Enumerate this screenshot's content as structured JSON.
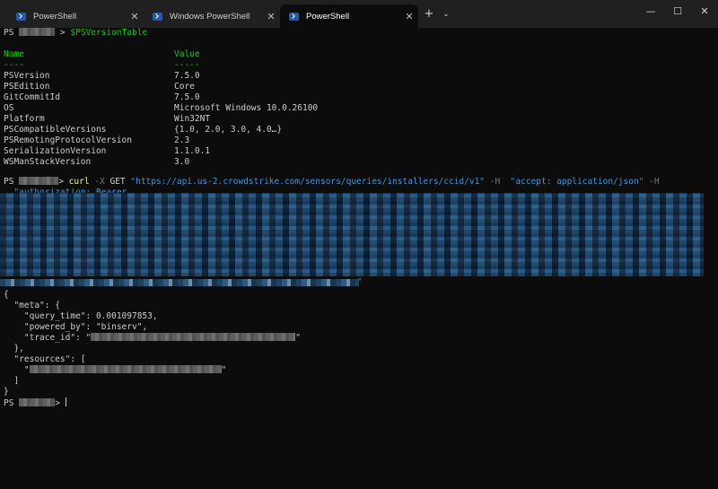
{
  "window": {
    "tabs": [
      {
        "label": "PowerShell",
        "active": false,
        "icon": "powershell-icon"
      },
      {
        "label": "Windows PowerShell",
        "active": false,
        "icon": "powershell-icon"
      },
      {
        "label": "PowerShell",
        "active": true,
        "icon": "powershell-icon"
      }
    ],
    "new_tab": "+",
    "tab_dropdown": "⌄",
    "controls": {
      "minimize": "—",
      "maximize": "☐",
      "close": "✕"
    }
  },
  "terminal": {
    "prompt_prefix": "PS",
    "prompt_suffix": ">",
    "cmd1": "$PSVersionTable",
    "table": {
      "headers": [
        "Name",
        "Value"
      ],
      "underlines": [
        "----",
        "-----"
      ],
      "rows": [
        [
          "PSVersion",
          "7.5.0"
        ],
        [
          "PSEdition",
          "Core"
        ],
        [
          "GitCommitId",
          "7.5.0"
        ],
        [
          "OS",
          "Microsoft Windows 10.0.26100"
        ],
        [
          "Platform",
          "Win32NT"
        ],
        [
          "PSCompatibleVersions",
          "{1.0, 2.0, 3.0, 4.0…}"
        ],
        [
          "PSRemotingProtocolVersion",
          "2.3"
        ],
        [
          "SerializationVersion",
          "1.1.0.1"
        ],
        [
          "WSManStackVersion",
          "3.0"
        ]
      ]
    },
    "curl": {
      "cmd": "curl",
      "flag_x": "-X",
      "method": "GET",
      "url": "\"https://api.us-2.crowdstrike.com/sensors/queries/installers/ccid/v1\"",
      "flag_h": "-H",
      "accept": "\"accept: application/json\"",
      "flag_h2": "-H",
      "auth": "\"authorization: Bearer",
      "auth_close": "\""
    },
    "json_output": {
      "l1": "{",
      "l2": "  \"meta\": {",
      "l3_key": "    \"query_time\": ",
      "l3_val": "0.001097853,",
      "l4_key": "    \"powered_by\": ",
      "l4_val": "\"binserv\",",
      "l5_key": "    \"trace_id\": ",
      "l5_open": "\"",
      "l5_close": "\"",
      "l6": "  },",
      "l7": "  \"resources\": [",
      "l8_open": "    \"",
      "l8_close": "\"",
      "l9": "  ]",
      "l10": "}"
    },
    "colors": {
      "background": "#0c0c0c",
      "text": "#cccccc",
      "header": "#16c60c",
      "command": "#f9f1a5",
      "string": "#3a96dd",
      "flag": "#767676"
    }
  }
}
